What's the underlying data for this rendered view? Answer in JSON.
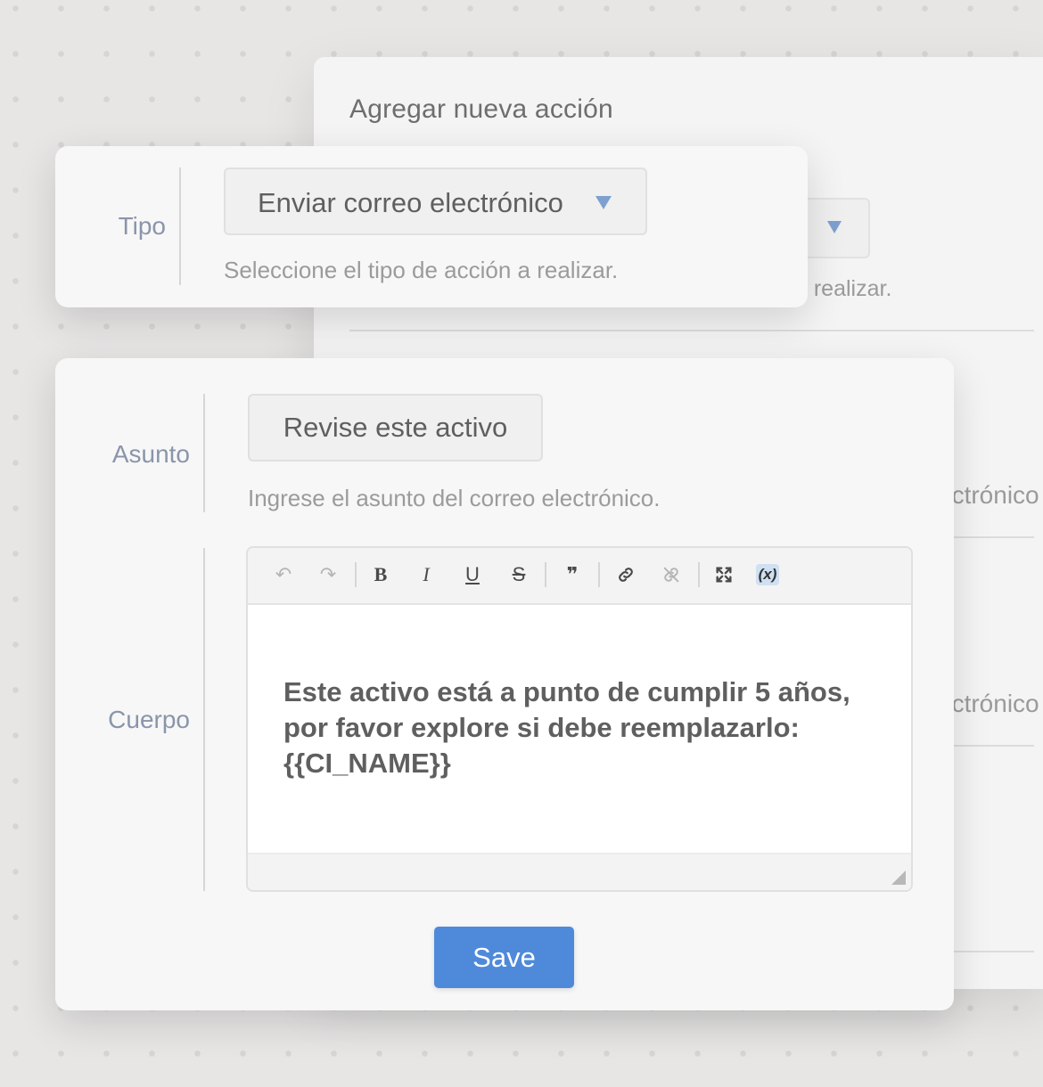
{
  "background_panel": {
    "title": "Agregar nueva acción",
    "type_hint_fragment": "a realizar.",
    "subject_hint_fragment": "ectrónico",
    "body_hint_fragment": "ectrónico"
  },
  "type_field": {
    "label": "Tipo",
    "value": "Enviar correo electrónico",
    "hint": "Seleccione el tipo de acción a realizar."
  },
  "subject_field": {
    "label": "Asunto",
    "value": "Revise este activo",
    "hint": "Ingrese el asunto del correo electrónico."
  },
  "body_field": {
    "label": "Cuerpo",
    "toolbar": [
      {
        "name": "undo-icon",
        "glyph": "↶",
        "enabled": false
      },
      {
        "name": "redo-icon",
        "glyph": "↷",
        "enabled": false
      },
      {
        "name": "bold-icon",
        "glyph": "B",
        "enabled": true
      },
      {
        "name": "italic-icon",
        "glyph": "I",
        "enabled": true
      },
      {
        "name": "underline-icon",
        "glyph": "U",
        "enabled": true
      },
      {
        "name": "strikethrough-icon",
        "glyph": "S",
        "enabled": true
      },
      {
        "name": "blockquote-icon",
        "glyph": "❞",
        "enabled": true
      },
      {
        "name": "link-icon",
        "glyph": "🔗",
        "enabled": true
      },
      {
        "name": "unlink-icon",
        "glyph": "⛓",
        "enabled": false
      },
      {
        "name": "fullscreen-icon",
        "glyph": "⤧",
        "enabled": true
      },
      {
        "name": "variable-icon",
        "glyph": "(x)",
        "enabled": true
      }
    ],
    "text_line1": "Este activo está a punto de cumplir 5 años,",
    "text_line2": "por favor explore si debe reemplazarlo:",
    "text_line3": "{{CI_NAME}}"
  },
  "save_label": "Save",
  "colors": {
    "accent": "#4f8ada",
    "label": "#8a95aa",
    "dropdown_arrow": "#7ea0cf"
  }
}
